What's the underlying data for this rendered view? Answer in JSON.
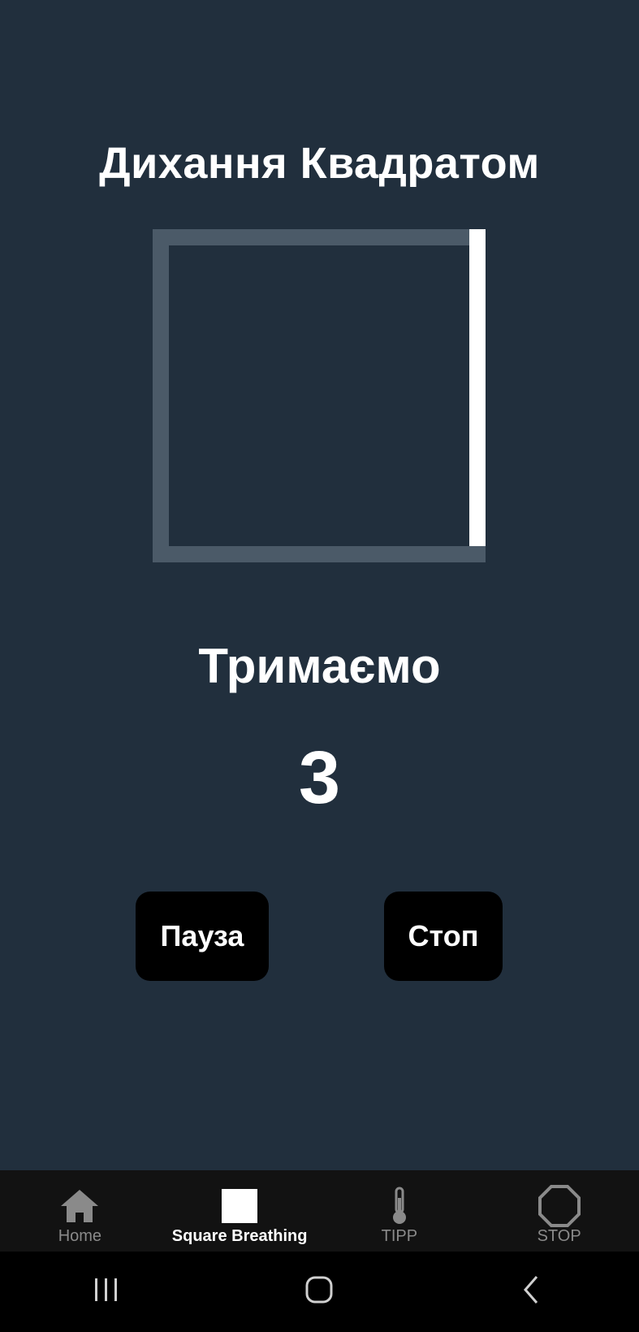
{
  "app": {
    "title": "Дихання Квадратом",
    "phase_label": "Тримаємо",
    "countdown": "3",
    "progress": {
      "completed_sides": [
        "top",
        "right"
      ],
      "active_side": "right",
      "colors": {
        "track": "#4b5a68",
        "active": "#ffffff",
        "background": "#212f3d"
      }
    }
  },
  "controls": {
    "pause_label": "Пауза",
    "stop_label": "Стоп"
  },
  "tabbar": {
    "items": [
      {
        "label": "Home",
        "icon": "home-icon",
        "active": false
      },
      {
        "label": "Square Breathing",
        "icon": "square-icon",
        "active": true
      },
      {
        "label": "TIPP",
        "icon": "thermometer-icon",
        "active": false
      },
      {
        "label": "STOP",
        "icon": "octagon-icon",
        "active": false
      }
    ]
  },
  "system_nav": {
    "items": [
      {
        "icon": "recent-apps-icon"
      },
      {
        "icon": "home-circle-icon"
      },
      {
        "icon": "back-chevron-icon"
      }
    ]
  }
}
